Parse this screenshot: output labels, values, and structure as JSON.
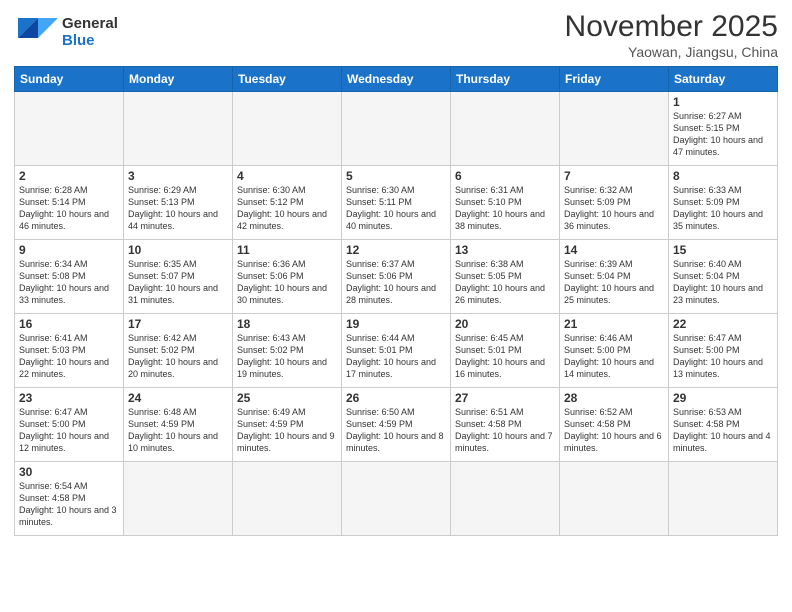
{
  "logo": {
    "general": "General",
    "blue": "Blue"
  },
  "title": "November 2025",
  "location": "Yaowan, Jiangsu, China",
  "days_of_week": [
    "Sunday",
    "Monday",
    "Tuesday",
    "Wednesday",
    "Thursday",
    "Friday",
    "Saturday"
  ],
  "weeks": [
    [
      {
        "day": "",
        "info": "",
        "empty": true
      },
      {
        "day": "",
        "info": "",
        "empty": true
      },
      {
        "day": "",
        "info": "",
        "empty": true
      },
      {
        "day": "",
        "info": "",
        "empty": true
      },
      {
        "day": "",
        "info": "",
        "empty": true
      },
      {
        "day": "",
        "info": "",
        "empty": true
      },
      {
        "day": "1",
        "info": "Sunrise: 6:27 AM\nSunset: 5:15 PM\nDaylight: 10 hours and 47 minutes."
      }
    ],
    [
      {
        "day": "2",
        "info": "Sunrise: 6:28 AM\nSunset: 5:14 PM\nDaylight: 10 hours and 46 minutes."
      },
      {
        "day": "3",
        "info": "Sunrise: 6:29 AM\nSunset: 5:13 PM\nDaylight: 10 hours and 44 minutes."
      },
      {
        "day": "4",
        "info": "Sunrise: 6:30 AM\nSunset: 5:12 PM\nDaylight: 10 hours and 42 minutes."
      },
      {
        "day": "5",
        "info": "Sunrise: 6:30 AM\nSunset: 5:11 PM\nDaylight: 10 hours and 40 minutes."
      },
      {
        "day": "6",
        "info": "Sunrise: 6:31 AM\nSunset: 5:10 PM\nDaylight: 10 hours and 38 minutes."
      },
      {
        "day": "7",
        "info": "Sunrise: 6:32 AM\nSunset: 5:09 PM\nDaylight: 10 hours and 36 minutes."
      },
      {
        "day": "8",
        "info": "Sunrise: 6:33 AM\nSunset: 5:09 PM\nDaylight: 10 hours and 35 minutes."
      }
    ],
    [
      {
        "day": "9",
        "info": "Sunrise: 6:34 AM\nSunset: 5:08 PM\nDaylight: 10 hours and 33 minutes."
      },
      {
        "day": "10",
        "info": "Sunrise: 6:35 AM\nSunset: 5:07 PM\nDaylight: 10 hours and 31 minutes."
      },
      {
        "day": "11",
        "info": "Sunrise: 6:36 AM\nSunset: 5:06 PM\nDaylight: 10 hours and 30 minutes."
      },
      {
        "day": "12",
        "info": "Sunrise: 6:37 AM\nSunset: 5:06 PM\nDaylight: 10 hours and 28 minutes."
      },
      {
        "day": "13",
        "info": "Sunrise: 6:38 AM\nSunset: 5:05 PM\nDaylight: 10 hours and 26 minutes."
      },
      {
        "day": "14",
        "info": "Sunrise: 6:39 AM\nSunset: 5:04 PM\nDaylight: 10 hours and 25 minutes."
      },
      {
        "day": "15",
        "info": "Sunrise: 6:40 AM\nSunset: 5:04 PM\nDaylight: 10 hours and 23 minutes."
      }
    ],
    [
      {
        "day": "16",
        "info": "Sunrise: 6:41 AM\nSunset: 5:03 PM\nDaylight: 10 hours and 22 minutes."
      },
      {
        "day": "17",
        "info": "Sunrise: 6:42 AM\nSunset: 5:02 PM\nDaylight: 10 hours and 20 minutes."
      },
      {
        "day": "18",
        "info": "Sunrise: 6:43 AM\nSunset: 5:02 PM\nDaylight: 10 hours and 19 minutes."
      },
      {
        "day": "19",
        "info": "Sunrise: 6:44 AM\nSunset: 5:01 PM\nDaylight: 10 hours and 17 minutes."
      },
      {
        "day": "20",
        "info": "Sunrise: 6:45 AM\nSunset: 5:01 PM\nDaylight: 10 hours and 16 minutes."
      },
      {
        "day": "21",
        "info": "Sunrise: 6:46 AM\nSunset: 5:00 PM\nDaylight: 10 hours and 14 minutes."
      },
      {
        "day": "22",
        "info": "Sunrise: 6:47 AM\nSunset: 5:00 PM\nDaylight: 10 hours and 13 minutes."
      }
    ],
    [
      {
        "day": "23",
        "info": "Sunrise: 6:47 AM\nSunset: 5:00 PM\nDaylight: 10 hours and 12 minutes."
      },
      {
        "day": "24",
        "info": "Sunrise: 6:48 AM\nSunset: 4:59 PM\nDaylight: 10 hours and 10 minutes."
      },
      {
        "day": "25",
        "info": "Sunrise: 6:49 AM\nSunset: 4:59 PM\nDaylight: 10 hours and 9 minutes."
      },
      {
        "day": "26",
        "info": "Sunrise: 6:50 AM\nSunset: 4:59 PM\nDaylight: 10 hours and 8 minutes."
      },
      {
        "day": "27",
        "info": "Sunrise: 6:51 AM\nSunset: 4:58 PM\nDaylight: 10 hours and 7 minutes."
      },
      {
        "day": "28",
        "info": "Sunrise: 6:52 AM\nSunset: 4:58 PM\nDaylight: 10 hours and 6 minutes."
      },
      {
        "day": "29",
        "info": "Sunrise: 6:53 AM\nSunset: 4:58 PM\nDaylight: 10 hours and 4 minutes."
      }
    ],
    [
      {
        "day": "30",
        "info": "Sunrise: 6:54 AM\nSunset: 4:58 PM\nDaylight: 10 hours and 3 minutes."
      },
      {
        "day": "",
        "info": "",
        "empty": true
      },
      {
        "day": "",
        "info": "",
        "empty": true
      },
      {
        "day": "",
        "info": "",
        "empty": true
      },
      {
        "day": "",
        "info": "",
        "empty": true
      },
      {
        "day": "",
        "info": "",
        "empty": true
      },
      {
        "day": "",
        "info": "",
        "empty": true
      }
    ]
  ]
}
